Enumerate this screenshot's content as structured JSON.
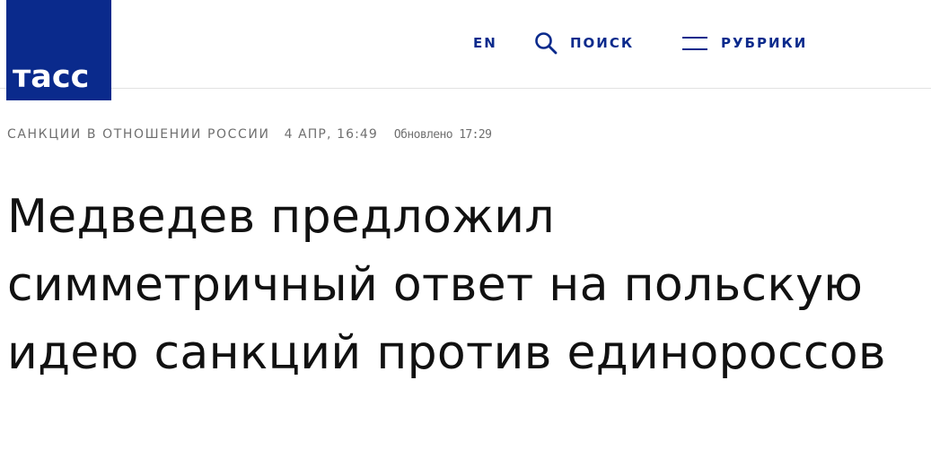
{
  "header": {
    "logo_text": "тасс",
    "nav": {
      "language_label": "EN",
      "search_label": "ПОИСК",
      "rubrics_label": "РУБРИКИ"
    },
    "colors": {
      "brand": "#0a2a8c"
    },
    "icons": {
      "search": "search-icon",
      "menu": "menu-icon"
    }
  },
  "article": {
    "category": "САНКЦИИ В ОТНОШЕНИИ РОССИИ",
    "date": "4 АПР, 16:49",
    "updated": "Обновлено 17:29",
    "title": "Медведев предложил симметричный ответ на польскую идею санкций против единороссов"
  }
}
